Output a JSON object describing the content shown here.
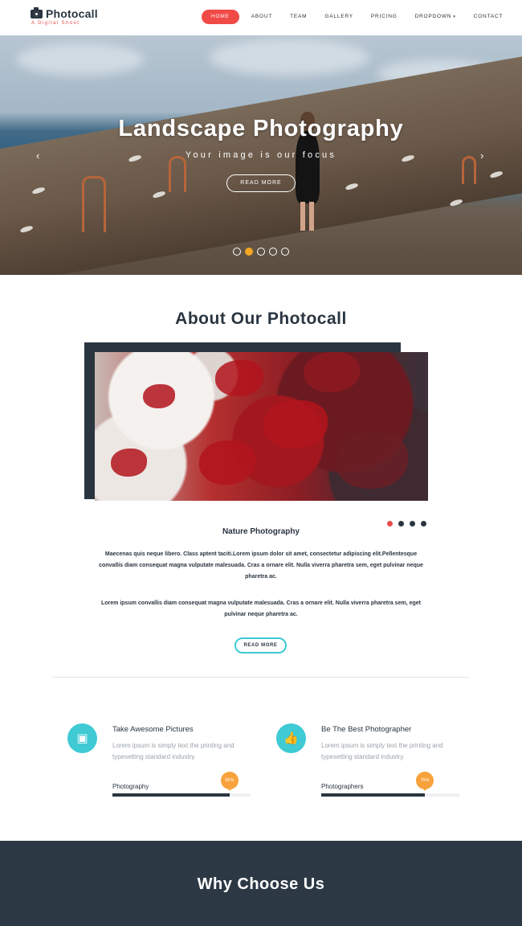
{
  "brand": {
    "title": "Photocall",
    "subtitle": "A Digital Shoot"
  },
  "nav": {
    "items": [
      {
        "label": "HOME",
        "active": true
      },
      {
        "label": "ABOUT"
      },
      {
        "label": "TEAM"
      },
      {
        "label": "GALLERY"
      },
      {
        "label": "PRICING"
      },
      {
        "label": "DROPDOWN"
      },
      {
        "label": "CONTACT"
      }
    ],
    "dropdown_caret": "▾"
  },
  "hero": {
    "title": "Landscape Photography",
    "subtitle": "Your image is our focus",
    "button": "READ MORE",
    "prev_arrow": "‹",
    "next_arrow": "›",
    "active_dot": 1
  },
  "about": {
    "title": "About Our Photocall",
    "heading": "Nature Photography",
    "paragraph1": "Maecenas quis neque libero. Class aptent taciti.Lorem ipsum dolor sit amet, consectetur adipiscing elit.Pellentesque convallis diam consequat magna vulputate malesuada. Cras a ornare elit. Nulla viverra pharetra sem, eget pulvinar neque pharetra ac.",
    "paragraph2": "Lorem ipsum convallis diam consequat magna vulputate malesuada. Cras a ornare elit. Nulla viverra pharetra sem, eget pulvinar neque pharetra ac.",
    "button": "READ MORE",
    "active_dot": 0
  },
  "features": [
    {
      "icon": "picture-icon",
      "glyph": "▣",
      "title": "Take Awesome Pictures",
      "desc": "Lorem ipsum is simply text the printing and typesetting standard industry.",
      "skill": "Photography",
      "percent": 85,
      "percent_label": "85%"
    },
    {
      "icon": "thumbs-up-icon",
      "glyph": "👍",
      "title": "Be The Best Photographer",
      "desc": "Lorem ipsum is simply text the printing and typesetting standard industry.",
      "skill": "Photographers",
      "percent": 75,
      "percent_label": "75%"
    }
  ],
  "why": {
    "title": "Why Choose Us"
  },
  "colors": {
    "accent": "#f04a47",
    "teal": "#3fcad4",
    "orange": "#f7a23b",
    "dark": "#2a3540"
  }
}
